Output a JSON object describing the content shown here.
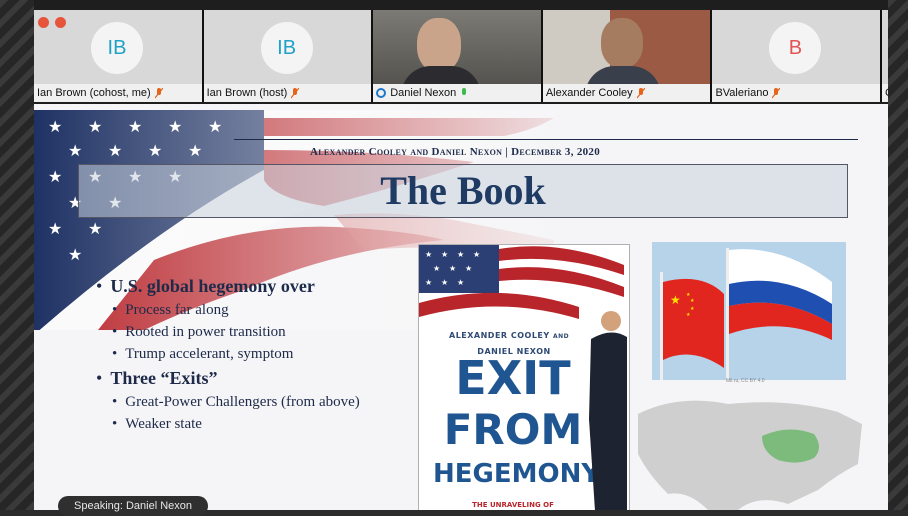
{
  "participants": [
    {
      "initials": "IB",
      "name": "Ian Brown (cohost, me)",
      "muted": true
    },
    {
      "initials": "IB",
      "name": "Ian Brown (host)",
      "muted": true
    },
    {
      "initials": "",
      "name": "Daniel Nexon",
      "muted": false
    },
    {
      "initials": "",
      "name": "Alexander Cooley",
      "muted": true
    },
    {
      "initials": "B",
      "name": "BValeriano",
      "muted": true
    },
    {
      "initials": "",
      "name": "C",
      "muted": false
    }
  ],
  "slide": {
    "authors_line": "Alexander Cooley and Daniel Nexon | December 3, 2020",
    "title": "The Book",
    "bullets": {
      "b1": "U.S. global hegemony over",
      "b1_sub": [
        "Process far along",
        "Rooted in power transition",
        "Trump accelerant, symptom"
      ],
      "b2": "Three “Exits”",
      "b2_sub": [
        "Great-Power Challengers (from above)",
        "Weaker state"
      ]
    },
    "cover": {
      "authors": [
        "ALEXANDER COOLEY",
        "AND",
        "DANIEL NEXON"
      ],
      "line1": "EXIT",
      "line2": "FROM",
      "line3": "HEGEMONY",
      "subtitle_partial": "THE UNRAVELING OF"
    },
    "photo_credit": "Mil.ru, CC BY 4.0"
  },
  "speaking": "Speaking: Daniel Nexon",
  "colors": {
    "accent": "#1f3a63",
    "muted_mic": "#e5641b",
    "live_mic": "#3fb950",
    "avatar_text": "#20a2c8",
    "avatar_text_b": "#e25555"
  }
}
